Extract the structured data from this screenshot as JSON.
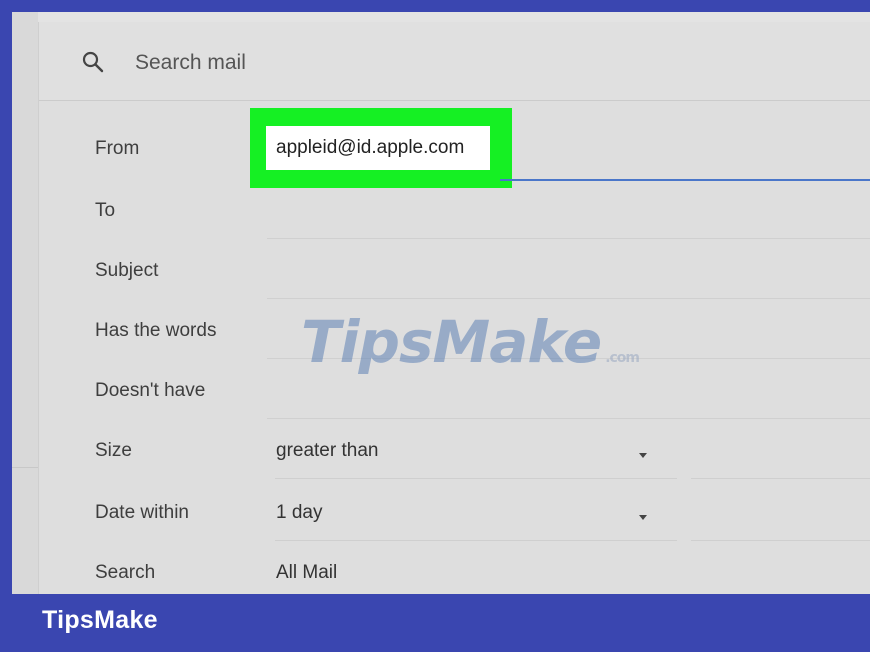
{
  "search": {
    "placeholder": "Search mail"
  },
  "form": {
    "from": {
      "label": "From",
      "value": "appleid@id.apple.com"
    },
    "to": {
      "label": "To"
    },
    "subject": {
      "label": "Subject"
    },
    "has_words": {
      "label": "Has the words"
    },
    "doesnt_have": {
      "label": "Doesn't have"
    },
    "size": {
      "label": "Size",
      "selected": "greater than"
    },
    "date_within": {
      "label": "Date within",
      "selected": "1 day"
    },
    "search_in": {
      "label": "Search",
      "selected": "All Mail"
    }
  },
  "watermark": {
    "text": "TipsMake",
    "suffix": ".com"
  },
  "footer": {
    "brand": "TipsMake"
  },
  "colors": {
    "frame_blue": "#3a46b0",
    "highlight_green": "#15f023",
    "input_underline": "#4a76c9"
  }
}
